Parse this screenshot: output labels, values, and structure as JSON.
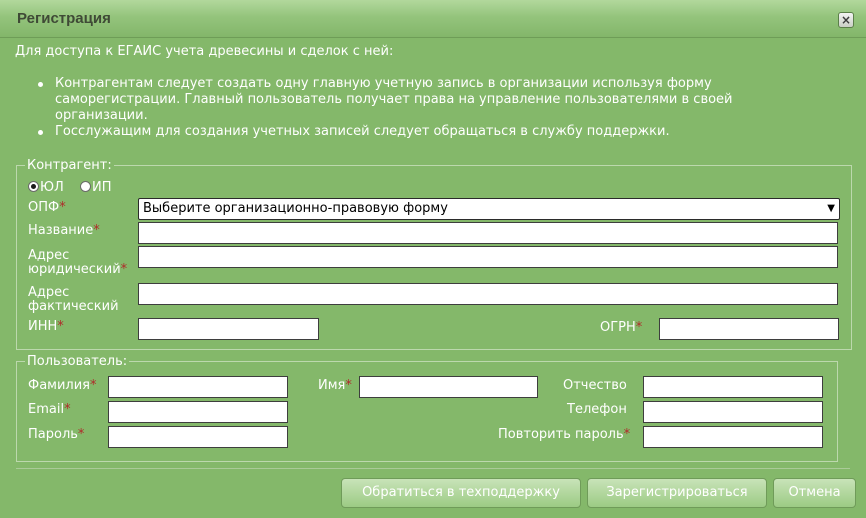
{
  "dialog": {
    "title": "Регистрация",
    "close_icon": "×"
  },
  "intro": "Для доступа к ЕГАИС учета древесины и сделок с ней:",
  "bullets": [
    "Контрагентам следует создать одну главную учетную запись в организации используя форму саморегистрации. Главный пользователь получает права на управление пользователями в своей организации.",
    "Госслужащим для создания учетных записей следует обращаться в службу поддержки."
  ],
  "contractor": {
    "legend": "Контрагент:",
    "radio_ul": "ЮЛ",
    "radio_ip": "ИП",
    "selected_type": "ЮЛ",
    "opf_label": "ОПФ",
    "opf_value": "Выберите организационно-правовую форму",
    "name_label": "Название",
    "legal_address_label_1": "Адрес",
    "legal_address_label_2": "юридический",
    "actual_address_label_1": "Адрес",
    "actual_address_label_2": "фактический",
    "inn_label": "ИНН",
    "ogrn_label": "ОГРН",
    "name_value": "",
    "legal_address_value": "",
    "actual_address_value": "",
    "inn_value": "",
    "ogrn_value": ""
  },
  "user": {
    "legend": "Пользователь:",
    "lastname_label": "Фамилия",
    "firstname_label": "Имя",
    "middlename_label": "Отчество",
    "email_label": "Email",
    "phone_label": "Телефон",
    "password_label": "Пароль",
    "repeat_password_label": "Повторить пароль",
    "lastname_value": "",
    "firstname_value": "",
    "middlename_value": "",
    "email_value": "",
    "phone_value": "",
    "password_value": "",
    "repeat_password_value": ""
  },
  "required_mark": "*",
  "buttons": {
    "support": "Обратиться в техподдержку",
    "register": "Зарегистрироваться",
    "cancel": "Отмена"
  },
  "colors": {
    "background": "#84b86a",
    "required": "#b02a2a",
    "title_text": "#3f4a36"
  }
}
